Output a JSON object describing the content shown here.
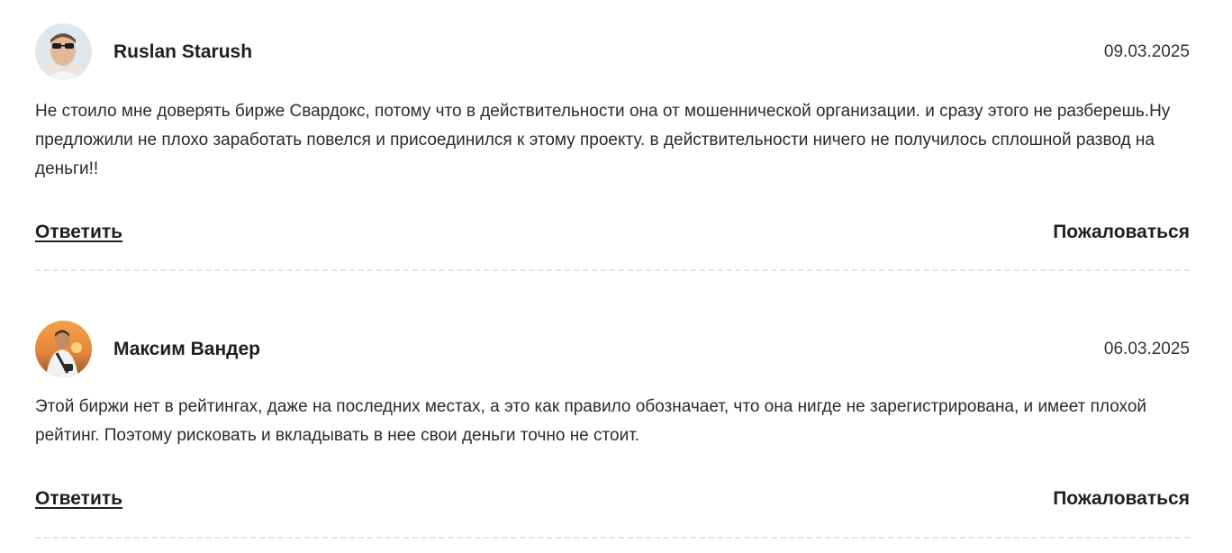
{
  "comments": [
    {
      "author": "Ruslan Starush",
      "date": "09.03.2025",
      "text": "Не стоило мне доверять бирже Свардокс, потому что в действительности она от мошеннической организации. и сразу этого не разберешь.Ну предложили не плохо заработать повелся и присоединился к этому проекту. в действительности ничего не получилось сплошной развод на деньги!!",
      "reply_label": "Ответить",
      "report_label": "Пожаловаться"
    },
    {
      "author": "Максим Вандер",
      "date": "06.03.2025",
      "text": "Этой биржи нет в рейтингах, даже на последних местах, а это как правило обозначает, что она нигде не зарегистрирована, и имеет плохой рейтинг. Поэтому рисковать и вкладывать в нее свои деньги точно не стоит.",
      "reply_label": "Ответить",
      "report_label": "Пожаловаться"
    }
  ]
}
